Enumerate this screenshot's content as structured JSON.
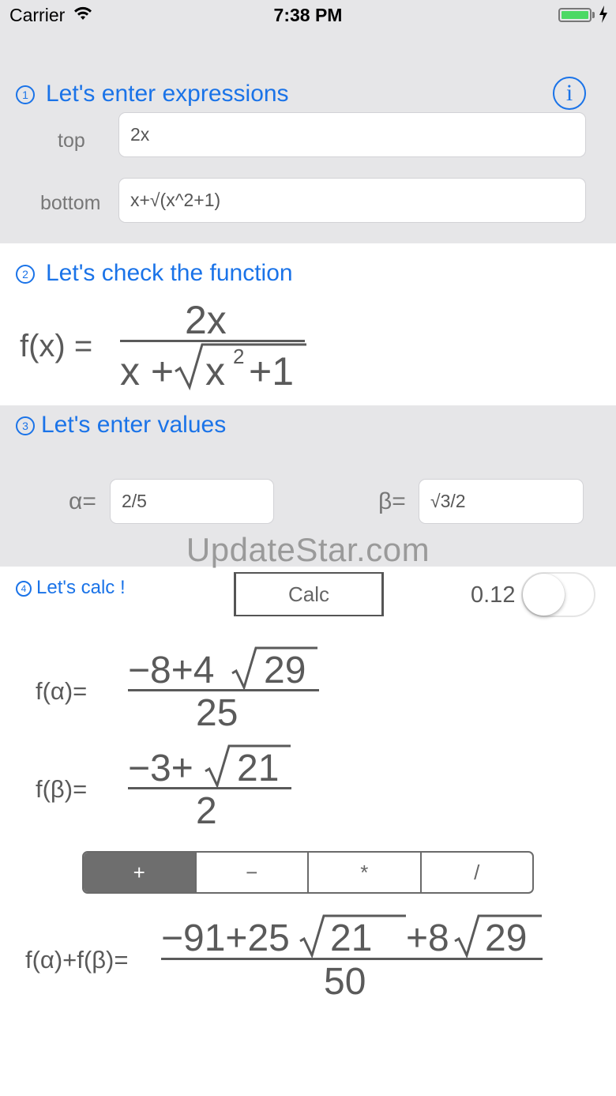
{
  "status_bar": {
    "carrier": "Carrier",
    "time": "7:38 PM"
  },
  "section1": {
    "number": "①",
    "title": "Let's enter expressions",
    "info_glyph": "i",
    "top_label": "top",
    "top_value": "2x",
    "bottom_label": "bottom",
    "bottom_value": "x+√(x^2+1)"
  },
  "section2": {
    "number": "②",
    "title": "Let's check the function",
    "lhs": "f(x) =",
    "numerator": "2x",
    "den_x": "x +",
    "den_rad_x": "x",
    "den_exp": "2",
    "den_rest": "+1"
  },
  "section3": {
    "number": "③",
    "title": "Let's enter values",
    "alpha_label": "α=",
    "alpha_value": "2/5",
    "beta_label": "β=",
    "beta_value": "√3/2"
  },
  "watermark": "UpdateStar.com",
  "section4": {
    "number": "④",
    "title": "Let's calc !",
    "calc_label": "Calc",
    "decimal_value": "0.12",
    "decimal_toggle_on": false
  },
  "results": {
    "f_alpha_lhs": "f(α)=",
    "f_alpha_num_pre": "−8+4",
    "f_alpha_num_rad": "29",
    "f_alpha_den": "25",
    "f_beta_lhs": "f(β)=",
    "f_beta_num_pre": "−3+",
    "f_beta_num_rad": "21",
    "f_beta_den": "2",
    "ops": [
      "+",
      "−",
      "*",
      "/"
    ],
    "selected_op": "+",
    "combo_lhs": "f(α)+f(β)=",
    "combo_num_pre": "−91+25",
    "combo_num_rad1": "21",
    "combo_num_mid": "+8",
    "combo_num_rad2": "29",
    "combo_den": "50"
  },
  "colors": {
    "accent": "#1a73e8",
    "panel_bg": "#e6e6e8",
    "math": "#5a5a5a",
    "battery": "#4cd964"
  }
}
